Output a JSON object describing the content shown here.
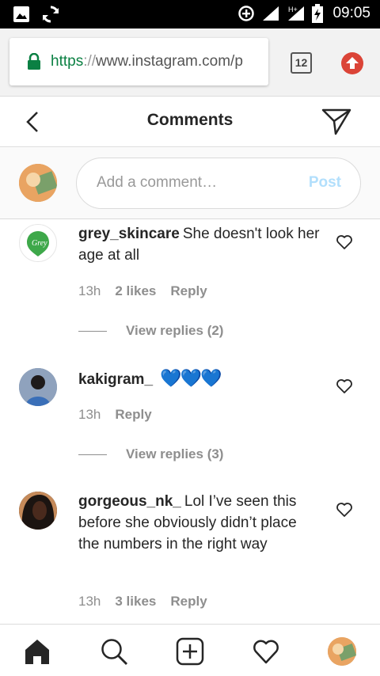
{
  "status_bar": {
    "time": "09:05",
    "network": "H+",
    "icons": [
      "image-icon",
      "sync-icon",
      "data-saver-icon",
      "signal-icon",
      "battery-icon"
    ]
  },
  "browser": {
    "url_scheme": "https",
    "url_sep": "://",
    "url_rest": "www.instagram.com/p",
    "tab_count": "12",
    "accent_color": "#0b8043",
    "update_color": "#db4437"
  },
  "header": {
    "title": "Comments"
  },
  "add_comment": {
    "placeholder": "Add a comment…",
    "post_label": "Post"
  },
  "comments": [
    {
      "user": "grey_skincare",
      "text": "She doesn't look her age at all",
      "time": "13h",
      "likes": "2 likes",
      "reply": "Reply",
      "view_replies": "View replies (2)"
    },
    {
      "user": "kakigram_",
      "text": "💙💙💙",
      "time": "13h",
      "reply": "Reply",
      "view_replies": "View replies (3)"
    },
    {
      "user": "gorgeous_nk_",
      "text": "Lol I’ve seen this before she obviously didn’t place the numbers in the right way",
      "time": "13h",
      "likes": "3 likes",
      "reply": "Reply"
    }
  ],
  "tabs": [
    "home-icon",
    "search-icon",
    "new-post-icon",
    "activity-heart-icon",
    "profile-avatar"
  ],
  "colors": {
    "link_blue_disabled": "#b2dffc",
    "muted_text": "#8e8e8e",
    "primary_text": "#262626",
    "heart_blue": "#3db8f1"
  }
}
